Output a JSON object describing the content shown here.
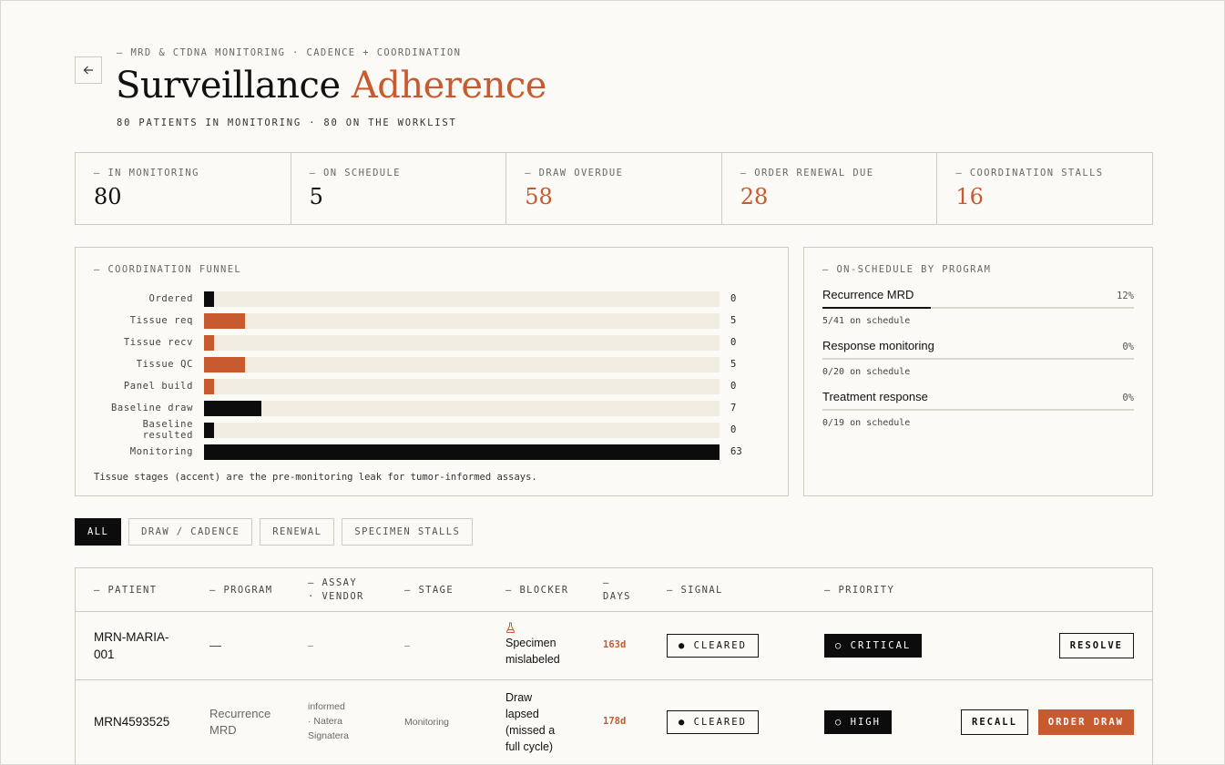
{
  "header": {
    "eyebrow": "— MRD & CTDNA MONITORING · CADENCE + COORDINATION",
    "title_main": "Surveillance",
    "title_accent": "Adherence",
    "subtitle": "80 PATIENTS IN MONITORING · 80 ON THE WORKLIST"
  },
  "stats": [
    {
      "label": "— IN MONITORING",
      "value": "80"
    },
    {
      "label": "— ON SCHEDULE",
      "value": "5"
    },
    {
      "label": "— DRAW OVERDUE",
      "value": "58"
    },
    {
      "label": "— ORDER RENEWAL DUE",
      "value": "28"
    },
    {
      "label": "— COORDINATION STALLS",
      "value": "16"
    }
  ],
  "funnel": {
    "label": "— COORDINATION FUNNEL",
    "max": 63,
    "stages": [
      {
        "label": "Ordered",
        "count": 0,
        "kind": "dark"
      },
      {
        "label": "Tissue req",
        "count": 5,
        "kind": "accent"
      },
      {
        "label": "Tissue recv",
        "count": 0,
        "kind": "accent"
      },
      {
        "label": "Tissue QC",
        "count": 5,
        "kind": "accent"
      },
      {
        "label": "Panel build",
        "count": 0,
        "kind": "accent"
      },
      {
        "label": "Baseline draw",
        "count": 7,
        "kind": "dark"
      },
      {
        "label": "Baseline resulted",
        "count": 0,
        "kind": "dark"
      },
      {
        "label": "Monitoring",
        "count": 63,
        "kind": "dark"
      }
    ],
    "note": "Tissue stages (accent) are the pre-monitoring leak for tumor-informed assays."
  },
  "programs": {
    "label": "— ON-SCHEDULE BY PROGRAM",
    "items": [
      {
        "name": "Recurrence MRD",
        "pct": "12%",
        "fraction": 0.12,
        "sub": "5/41 on schedule"
      },
      {
        "name": "Response monitoring",
        "pct": "0%",
        "fraction": 0,
        "sub": "0/20 on schedule"
      },
      {
        "name": "Treatment response",
        "pct": "0%",
        "fraction": 0,
        "sub": "0/19 on schedule"
      }
    ]
  },
  "filters": [
    "ALL",
    "DRAW / CADENCE",
    "RENEWAL",
    "SPECIMEN STALLS"
  ],
  "table": {
    "headers": {
      "patient": "— PATIENT",
      "program": "— PROGRAM",
      "assay_1": "— ASSAY",
      "assay_2": "· VENDOR",
      "stage": "— STAGE",
      "blocker": "— BLOCKER",
      "days_1": "—",
      "days_2": "DAYS",
      "signal": "— SIGNAL",
      "priority": "— PRIORITY"
    },
    "rows": [
      {
        "patient_1": "MRN-MARIA-",
        "patient_2": "001",
        "program": "—",
        "assay": "–",
        "stage": "–",
        "blocker_1": "Specimen",
        "blocker_2": "mislabeled",
        "days": "163d",
        "signal": "● CLEARED",
        "priority": "○ CRITICAL",
        "action": "RESOLVE"
      },
      {
        "patient": "MRN4593525",
        "program_1": "Recurrence",
        "program_2": "MRD",
        "assay_1": "informed",
        "assay_2": "· Natera",
        "assay_3": "Signatera",
        "stage": "Monitoring",
        "blocker_1": "Draw",
        "blocker_2": "lapsed",
        "blocker_3": "(missed a",
        "blocker_4": "full cycle)",
        "days": "178d",
        "signal": "● CLEARED",
        "priority": "○ HIGH",
        "action_secondary": "RECALL",
        "action_primary": "ORDER DRAW"
      }
    ]
  },
  "colors": {
    "accent": "#c75a2f",
    "dark": "#0c0c0c",
    "track": "#f1ede3"
  },
  "icons": {
    "back": "arrow-left-icon",
    "blocker": "flask-icon"
  }
}
